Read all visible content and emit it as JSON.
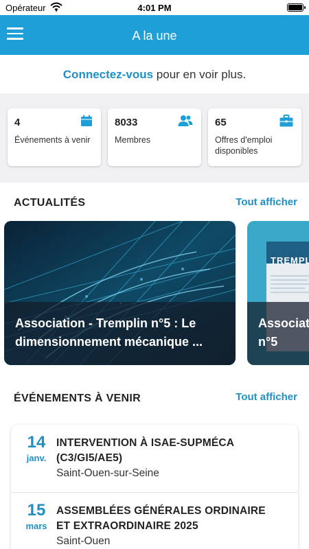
{
  "status_bar": {
    "carrier": "Opérateur",
    "time": "4:01 PM",
    "battery_level": 1.0
  },
  "header": {
    "title": "A la une",
    "menu_icon": "hamburger-menu-icon",
    "background_color": "#1f9fd8"
  },
  "login_prompt": {
    "link": "Connectez-vous",
    "text": " pour en voir plus."
  },
  "stats": [
    {
      "value": "4",
      "label": "Événements à venir",
      "icon": "calendar-icon"
    },
    {
      "value": "8033",
      "label": "Membres",
      "icon": "users-icon"
    },
    {
      "value": "65",
      "label": "Offres d'emploi disponibles",
      "icon": "briefcase-icon"
    }
  ],
  "news": {
    "title": "ACTUALITÉS",
    "see_all": "Tout afficher",
    "items": [
      {
        "caption_line1": "Association - Tremplin n°5 : Le",
        "caption_line2": "dimensionnement mécanique ..."
      },
      {
        "caption_line1": "Associat",
        "caption_line2": "n°5",
        "image_text": "TREMPLIN"
      }
    ]
  },
  "events": {
    "title": "ÉVÉNEMENTS À VENIR",
    "see_all": "Tout afficher",
    "items": [
      {
        "day": "14",
        "month": "janv.",
        "title_line1": "INTERVENTION À ISAE-SUPMÉCA",
        "title_line2": "(C3/GI5/AE5)",
        "place": "Saint-Ouen-sur-Seine"
      },
      {
        "day": "15",
        "month": "mars",
        "title_line1": "ASSEMBLÉES GÉNÉRALES ORDINAIRE",
        "title_line2": "ET EXTRAORDINAIRE 2025",
        "place": "Saint-Ouen"
      }
    ]
  },
  "colors": {
    "accent": "#1f9fd8",
    "link": "#1f8fc6"
  }
}
